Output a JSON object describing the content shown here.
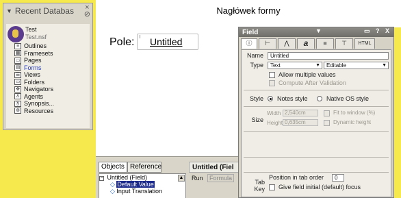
{
  "recent": {
    "header": "Recent Databas",
    "close": "×",
    "database": {
      "title": "Test",
      "file": "Test.nsf"
    },
    "items": [
      {
        "label": "Outlines",
        "icon": "outline-icon"
      },
      {
        "label": "Framesets",
        "icon": "frameset-icon"
      },
      {
        "label": "Pages",
        "icon": "page-icon"
      },
      {
        "label": "Forms",
        "icon": "form-icon",
        "selected": true
      },
      {
        "label": "Views",
        "icon": "view-icon"
      },
      {
        "label": "Folders",
        "icon": "folder-icon"
      },
      {
        "label": "Navigators",
        "icon": "navigator-icon"
      },
      {
        "label": "Agents",
        "icon": "agent-icon"
      },
      {
        "label": "Synopsis...",
        "icon": "synopsis-icon"
      },
      {
        "label": "Resources",
        "icon": "resources-icon"
      }
    ]
  },
  "form": {
    "heading": "Nagłówek formy",
    "field_label": "Pole:",
    "field_value": "Untitled"
  },
  "objects_panel": {
    "tab_objects": "Objects",
    "tab_reference": "Reference",
    "rows": [
      {
        "expander": "−",
        "label": "Untitled (Field)"
      },
      {
        "label": "Default Value",
        "selected": true
      },
      {
        "label": "Input Translation"
      }
    ],
    "header_title": "Untitled (Fiel",
    "run_label": "Run",
    "formula_label": "Formula"
  },
  "dialog": {
    "title": "Field",
    "controls": "▭ ? X",
    "tabs": [
      "ⓘ",
      "⊢",
      "⋀",
      "a",
      "≡",
      "⊤",
      "HTML"
    ],
    "name_label": "Name",
    "name_value": "Untitled",
    "type_label": "Type",
    "type_value": "Text",
    "editable_value": "Editable",
    "allow_multiple": "Allow multiple values",
    "compute_after": "Compute After Validation",
    "style_label": "Style",
    "notes_style": "Notes style",
    "native_style": "Native OS style",
    "size_label": "Size",
    "width_label": "Width",
    "width_value": "2,540cm",
    "height_label": "Height",
    "height_value": "0,635cm",
    "fit_window": "Fit to window (%)",
    "dynamic_height": "Dynamic height",
    "tabkey_label": "Tab Key",
    "position_label": "Position in tab order",
    "position_value": "0",
    "initial_focus": "Give field initial (default) focus"
  }
}
